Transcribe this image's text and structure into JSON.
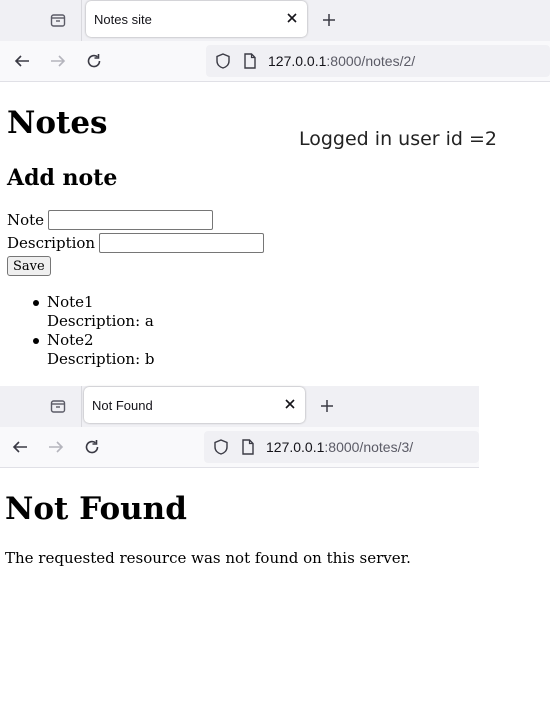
{
  "windows": [
    {
      "tab": {
        "title": "Notes site"
      },
      "address": {
        "host": "127.0.0.1",
        "rest": ":8000/notes/2/"
      },
      "page": {
        "heading": "Notes",
        "user_status": "Logged in user id =2",
        "add_heading": "Add note",
        "form": {
          "note_label": "Note",
          "note_value": "",
          "description_label": "Description",
          "description_value": "",
          "save_label": "Save"
        },
        "notes": [
          {
            "title": "Note1",
            "description": "Description: a"
          },
          {
            "title": "Note2",
            "description": "Description: b"
          }
        ]
      }
    },
    {
      "tab": {
        "title": "Not Found"
      },
      "address": {
        "host": "127.0.0.1",
        "rest": ":8000/notes/3/"
      },
      "page": {
        "heading": "Not Found",
        "message": "The requested resource was not found on this server."
      }
    }
  ],
  "icons": {
    "tab_manager": "tab-manager-icon",
    "close": "close-icon",
    "new_tab": "plus-icon",
    "back": "back-arrow-icon",
    "forward": "forward-arrow-icon",
    "reload": "reload-icon",
    "shield": "shield-icon",
    "page": "page-icon"
  },
  "colors": {
    "tabbar_bg": "#f0f0f4",
    "navbar_bg": "#f9f9fb",
    "urlbar_bg": "#f0f0f4",
    "url_rest": "#5b5b66"
  }
}
